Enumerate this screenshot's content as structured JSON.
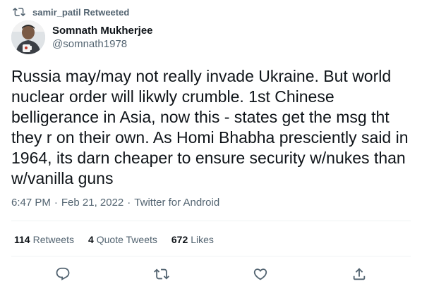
{
  "retweet_context": {
    "text": "samir_patil Retweeted",
    "icon": "retweet-icon"
  },
  "author": {
    "display_name": "Somnath Mukherjee",
    "handle": "@somnath1978"
  },
  "tweet": {
    "text": "Russia may/may not really invade Ukraine. But world\nnuclear order will likwly crumble. 1st Chinese\nbelligerance in Asia, now this - states get the msg tht\nthey r on their own. As Homi Bhabha presciently said in\n1964, its darn cheaper to ensure security w/nukes than\nw/vanilla guns"
  },
  "meta": {
    "time": "6:47 PM",
    "sep1": "·",
    "date": "Feb 21, 2022",
    "sep2": "·",
    "source": "Twitter for Android"
  },
  "stats": {
    "retweets_count": "114",
    "retweets_label": "Retweets",
    "quotes_count": "4",
    "quotes_label": "Quote Tweets",
    "likes_count": "672",
    "likes_label": "Likes"
  },
  "actions": [
    {
      "icon": "reply-icon"
    },
    {
      "icon": "retweet-icon"
    },
    {
      "icon": "like-icon"
    },
    {
      "icon": "share-icon"
    }
  ],
  "colors": {
    "text": "#0f1419",
    "secondary": "#536471",
    "divider": "#eff3f4"
  }
}
